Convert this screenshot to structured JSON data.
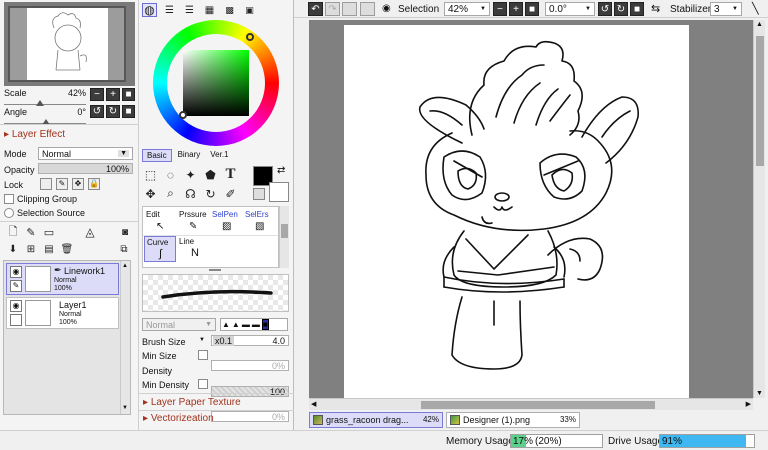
{
  "navigator": {
    "scale_label": "Scale",
    "scale_value": "42%",
    "angle_label": "Angle",
    "angle_value": "0°"
  },
  "layer_effect": {
    "header": "Layer Effect",
    "mode_label": "Mode",
    "mode_value": "Normal",
    "opacity_label": "Opacity",
    "opacity_value": "100%",
    "opacity_fraction": 1.0,
    "lock_label": "Lock",
    "clipping_group": "Clipping Group",
    "selection_source": "Selection Source"
  },
  "layers": [
    {
      "name": "Linework1",
      "mode": "Normal",
      "opacity": "100%",
      "selected": true
    },
    {
      "name": "Layer1",
      "mode": "Normal",
      "opacity": "100%",
      "selected": false
    }
  ],
  "color_tabs": {
    "basic": "Basic",
    "binary": "Binary",
    "ver1": "Ver.1"
  },
  "colors": {
    "foreground": "#000000",
    "background": "#ffffff",
    "accent_panel": "#dcdcf8"
  },
  "tools": {
    "edit": "Edit",
    "pressure": "Prssure",
    "selpen": "SelPen",
    "selers": "SelErs",
    "curve": "Curve",
    "line": "Line"
  },
  "brush": {
    "blend_mode": "Normal",
    "size_label": "Brush Size",
    "size_multiplier": "x0.1",
    "size_value": "4.0",
    "min_size_label": "Min Size",
    "min_size_value": "0%",
    "density_label": "Density",
    "density_value": "100",
    "min_density_label": "Min Density",
    "min_density_value": "0%",
    "paper_texture": "Layer Paper Texture",
    "vectorization": "Vectorizeation"
  },
  "toolbar": {
    "selection_label": "Selection",
    "zoom_value": "42%",
    "rotation_value": "0.0°",
    "stabilizer_label": "Stabilizer",
    "stabilizer_value": "3"
  },
  "documents": [
    {
      "name": "grass_racoon drag...",
      "zoom": "42%",
      "active": true
    },
    {
      "name": "Designer (1).png",
      "zoom": "33%",
      "active": false
    }
  ],
  "status": {
    "memory_label": "Memory Usage",
    "memory_value": "17%",
    "memory_paren": "(20%)",
    "memory_fraction": 0.17,
    "drive_label": "Drive Usage",
    "drive_value": "91%",
    "drive_fraction": 0.91
  }
}
